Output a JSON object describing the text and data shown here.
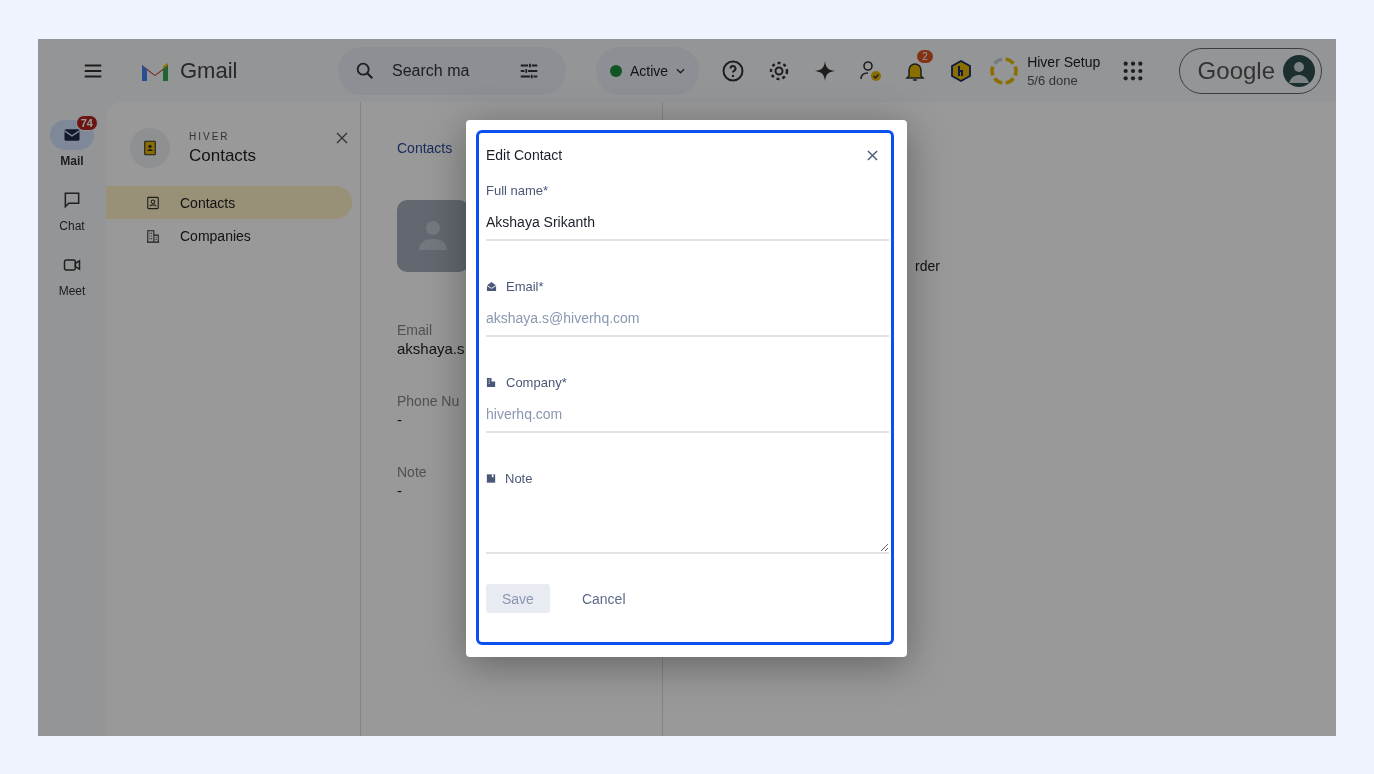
{
  "topbar": {
    "logo": "Gmail",
    "search": {
      "placeholder": "Search ma"
    },
    "status": {
      "label": "Active"
    },
    "notifications": "2",
    "setup": {
      "title": "Hiver Setup",
      "progress": "5/6 done",
      "level": 0.833
    },
    "account": "Google"
  },
  "rail": [
    {
      "kind": "mail",
      "label": "Mail",
      "badge": "74",
      "selected": true
    },
    {
      "kind": "chat",
      "label": "Chat",
      "selected": false
    },
    {
      "kind": "meet",
      "label": "Meet",
      "selected": false
    }
  ],
  "panel": {
    "brand": "HIVER",
    "title": "Contacts",
    "items": [
      {
        "kind": "contacts",
        "label": "Contacts",
        "selected": true
      },
      {
        "kind": "companies",
        "label": "Companies",
        "selected": false
      }
    ]
  },
  "detail": {
    "breadcrumb": "Contacts",
    "fields": [
      {
        "label": "Email",
        "value": "akshaya.s"
      },
      {
        "label": "Phone Nu",
        "value": "-"
      },
      {
        "label": "Note",
        "value": "-"
      }
    ],
    "side_text": "rder"
  },
  "modal": {
    "title": "Edit Contact",
    "fields": [
      {
        "kind": "name",
        "label": "Full name*",
        "value": "Akshaya Srikanth"
      },
      {
        "kind": "email",
        "label": "Email*",
        "placeholder": "akshaya.s@hiverhq.com"
      },
      {
        "kind": "company",
        "label": "Company*",
        "placeholder": "hiverhq.com"
      },
      {
        "kind": "note",
        "label": "Note"
      }
    ],
    "save": {
      "label": "Save",
      "disabled": true
    },
    "cancel": "Cancel"
  }
}
